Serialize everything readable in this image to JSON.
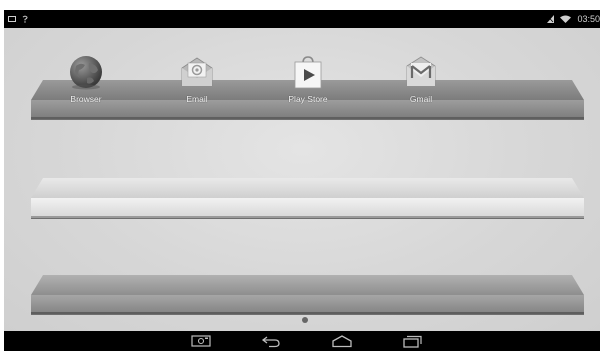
{
  "status_bar": {
    "left_icons": [
      "screen-icon",
      "wifi-question-icon"
    ],
    "right_icons": [
      "signal-icon",
      "wifi-icon"
    ],
    "time": "03:50"
  },
  "shelves": [
    {
      "apps": [
        {
          "label": "Browser",
          "icon": "globe-icon"
        },
        {
          "label": "Email",
          "icon": "email-icon"
        },
        {
          "label": "Play Store",
          "icon": "play-store-icon"
        },
        {
          "label": "Gmail",
          "icon": "gmail-icon"
        }
      ]
    },
    {
      "apps": []
    },
    {
      "apps": []
    }
  ],
  "nav_bar": {
    "buttons": [
      "screenshot-icon",
      "back-icon",
      "home-icon",
      "recent-apps-icon"
    ]
  },
  "colors": {
    "wallpaper": "#d8d8d8",
    "bars": "#000000"
  }
}
